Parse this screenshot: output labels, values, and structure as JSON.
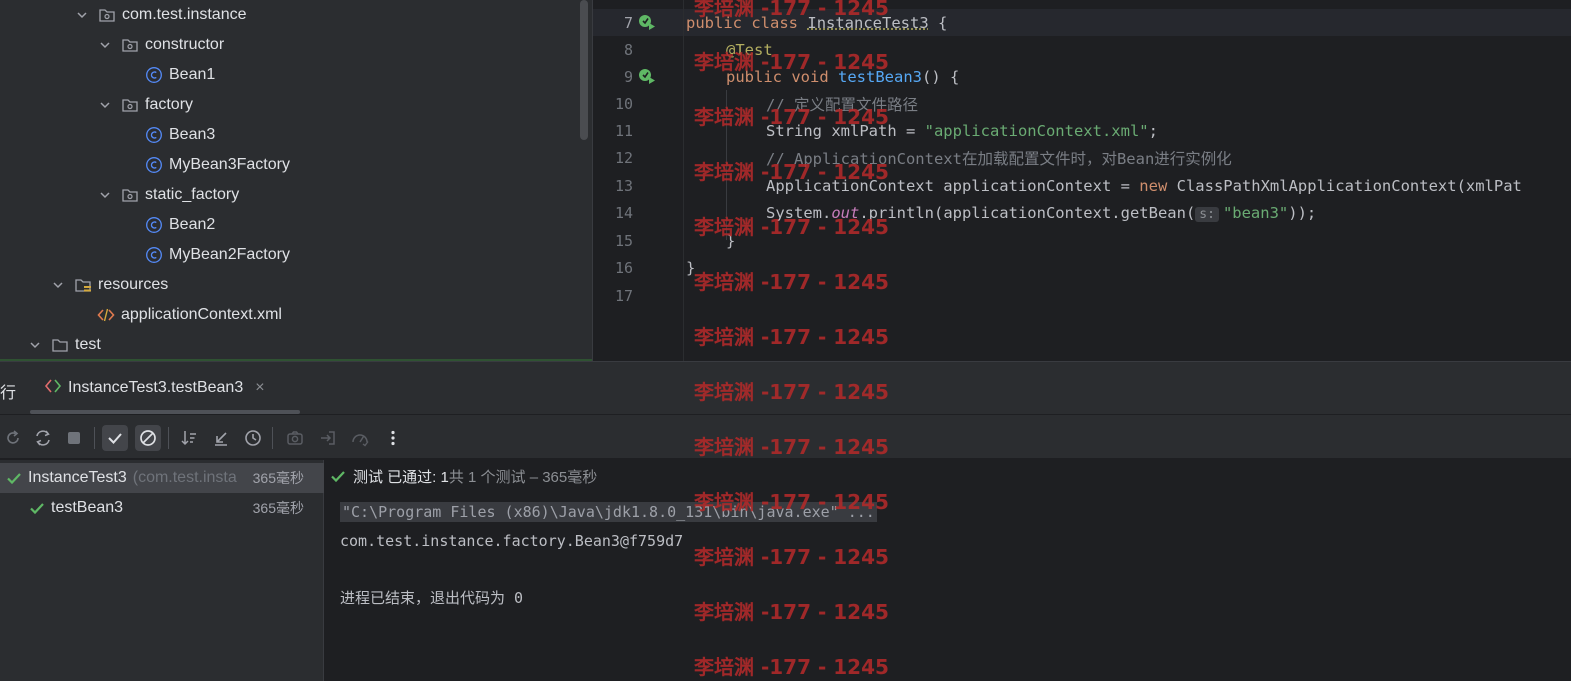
{
  "project_tree": {
    "items": [
      {
        "label": "com.test.instance",
        "icon": "package-icon",
        "expanded": true
      },
      {
        "label": "constructor",
        "icon": "package-icon",
        "expanded": true
      },
      {
        "label": "Bean1",
        "icon": "class-icon"
      },
      {
        "label": "factory",
        "icon": "package-icon",
        "expanded": true
      },
      {
        "label": "Bean3",
        "icon": "class-icon"
      },
      {
        "label": "MyBean3Factory",
        "icon": "class-icon"
      },
      {
        "label": "static_factory",
        "icon": "package-icon",
        "expanded": true
      },
      {
        "label": "Bean2",
        "icon": "class-icon"
      },
      {
        "label": "MyBean2Factory",
        "icon": "class-icon"
      },
      {
        "label": "resources",
        "icon": "resources-folder-icon",
        "expanded": true
      },
      {
        "label": "applicationContext.xml",
        "icon": "xml-file-icon"
      },
      {
        "label": "test",
        "icon": "folder-icon",
        "expanded": true
      }
    ]
  },
  "editor": {
    "line_numbers": [
      "7",
      "8",
      "9",
      "10",
      "11",
      "12",
      "13",
      "14",
      "15",
      "16",
      "17"
    ],
    "line7": {
      "kw1": "public",
      "kw2": "class",
      "cls": "InstanceTest3",
      "rest": " {"
    },
    "line8": {
      "ann": "@Test"
    },
    "line9": {
      "kw1": "public",
      "kw2": "void",
      "fn": "testBean3",
      "rest": "() {"
    },
    "line10": {
      "cmt": "// 定义配置文件路径"
    },
    "line11": {
      "a": "String xmlPath = ",
      "str": "\"applicationContext.xml\"",
      "b": ";"
    },
    "line12": {
      "cmt": "// ApplicationContext在加载配置文件时，对Bean进行实例化"
    },
    "line13": {
      "a": "ApplicationContext applicationContext = ",
      "kw": "new",
      "b": " ClassPathXmlApplicationContext(xmlPat"
    },
    "line14": {
      "a": "System.",
      "stat": "out",
      "b": ".println(applicationContext.getBean(",
      "hint": "s:",
      "str": "\"bean3\"",
      "c": "));"
    },
    "line15": {
      "a": "}"
    },
    "line16": {
      "a": "}"
    }
  },
  "run_panel": {
    "tool_label": "行",
    "tab_label": "InstanceTest3.testBean3",
    "tab_close": "×",
    "test_tree": [
      {
        "name": "InstanceTest3",
        "pkg": "(com.test.instance)",
        "time": "365毫秒"
      },
      {
        "name": "testBean3",
        "time": "365毫秒"
      }
    ],
    "status_main": "测试 已通过: 1",
    "status_rest": "共 1 个测试 – 365毫秒",
    "console": {
      "cmd": "\"C:\\Program Files (x86)\\Java\\jdk1.8.0_131\\bin\\java.exe\" ...",
      "output": "com.test.instance.factory.Bean3@f759d7",
      "exit": "进程已结束，退出代码为 0"
    }
  },
  "watermark": "李培渊 -177 - 1245",
  "colors": {
    "pass_green": "#5fb865",
    "class_icon_blue": "#548af7",
    "watermark_red": "#b22a2a"
  }
}
